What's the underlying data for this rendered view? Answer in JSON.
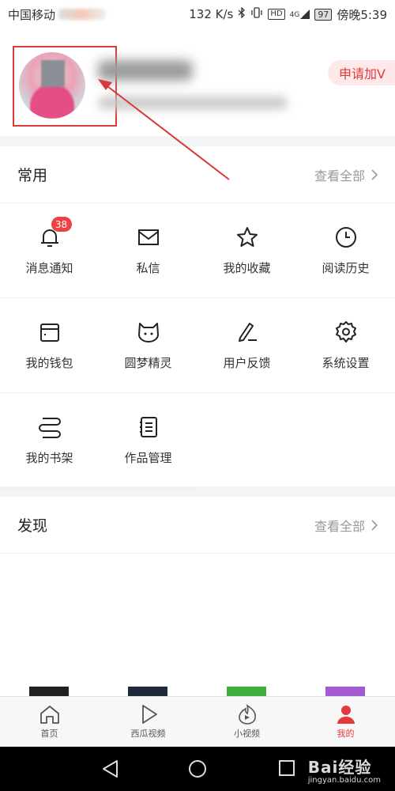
{
  "status_bar": {
    "carrier": "中国移动",
    "speed": "132 K/s",
    "hd_label": "HD",
    "net_label": "4G",
    "battery": "97",
    "time": "傍晚5:39"
  },
  "profile": {
    "apply_v_label": "申请加V"
  },
  "common": {
    "title": "常用",
    "see_all": "查看全部",
    "items": [
      {
        "label": "消息通知",
        "icon": "bell-icon",
        "badge": "38"
      },
      {
        "label": "私信",
        "icon": "mail-icon"
      },
      {
        "label": "我的收藏",
        "icon": "star-icon"
      },
      {
        "label": "阅读历史",
        "icon": "clock-icon"
      },
      {
        "label": "我的钱包",
        "icon": "wallet-icon"
      },
      {
        "label": "圆梦精灵",
        "icon": "cat-face-icon"
      },
      {
        "label": "用户反馈",
        "icon": "pen-icon"
      },
      {
        "label": "系统设置",
        "icon": "gear-icon"
      },
      {
        "label": "我的书架",
        "icon": "bookshelf-icon"
      },
      {
        "label": "作品管理",
        "icon": "document-list-icon"
      }
    ]
  },
  "discover": {
    "title": "发现",
    "see_all": "查看全部"
  },
  "bottom_nav": {
    "items": [
      {
        "label": "首页",
        "icon": "home-icon",
        "active": false
      },
      {
        "label": "西瓜视频",
        "icon": "play-icon",
        "active": false
      },
      {
        "label": "小视频",
        "icon": "flame-play-icon",
        "active": false
      },
      {
        "label": "我的",
        "icon": "person-icon",
        "active": true
      }
    ]
  },
  "watermark": {
    "brand": "Bai经验",
    "url": "jingyan.baidu.com"
  },
  "colors": {
    "accent": "#e3393c",
    "annotation": "#d93a3a"
  }
}
